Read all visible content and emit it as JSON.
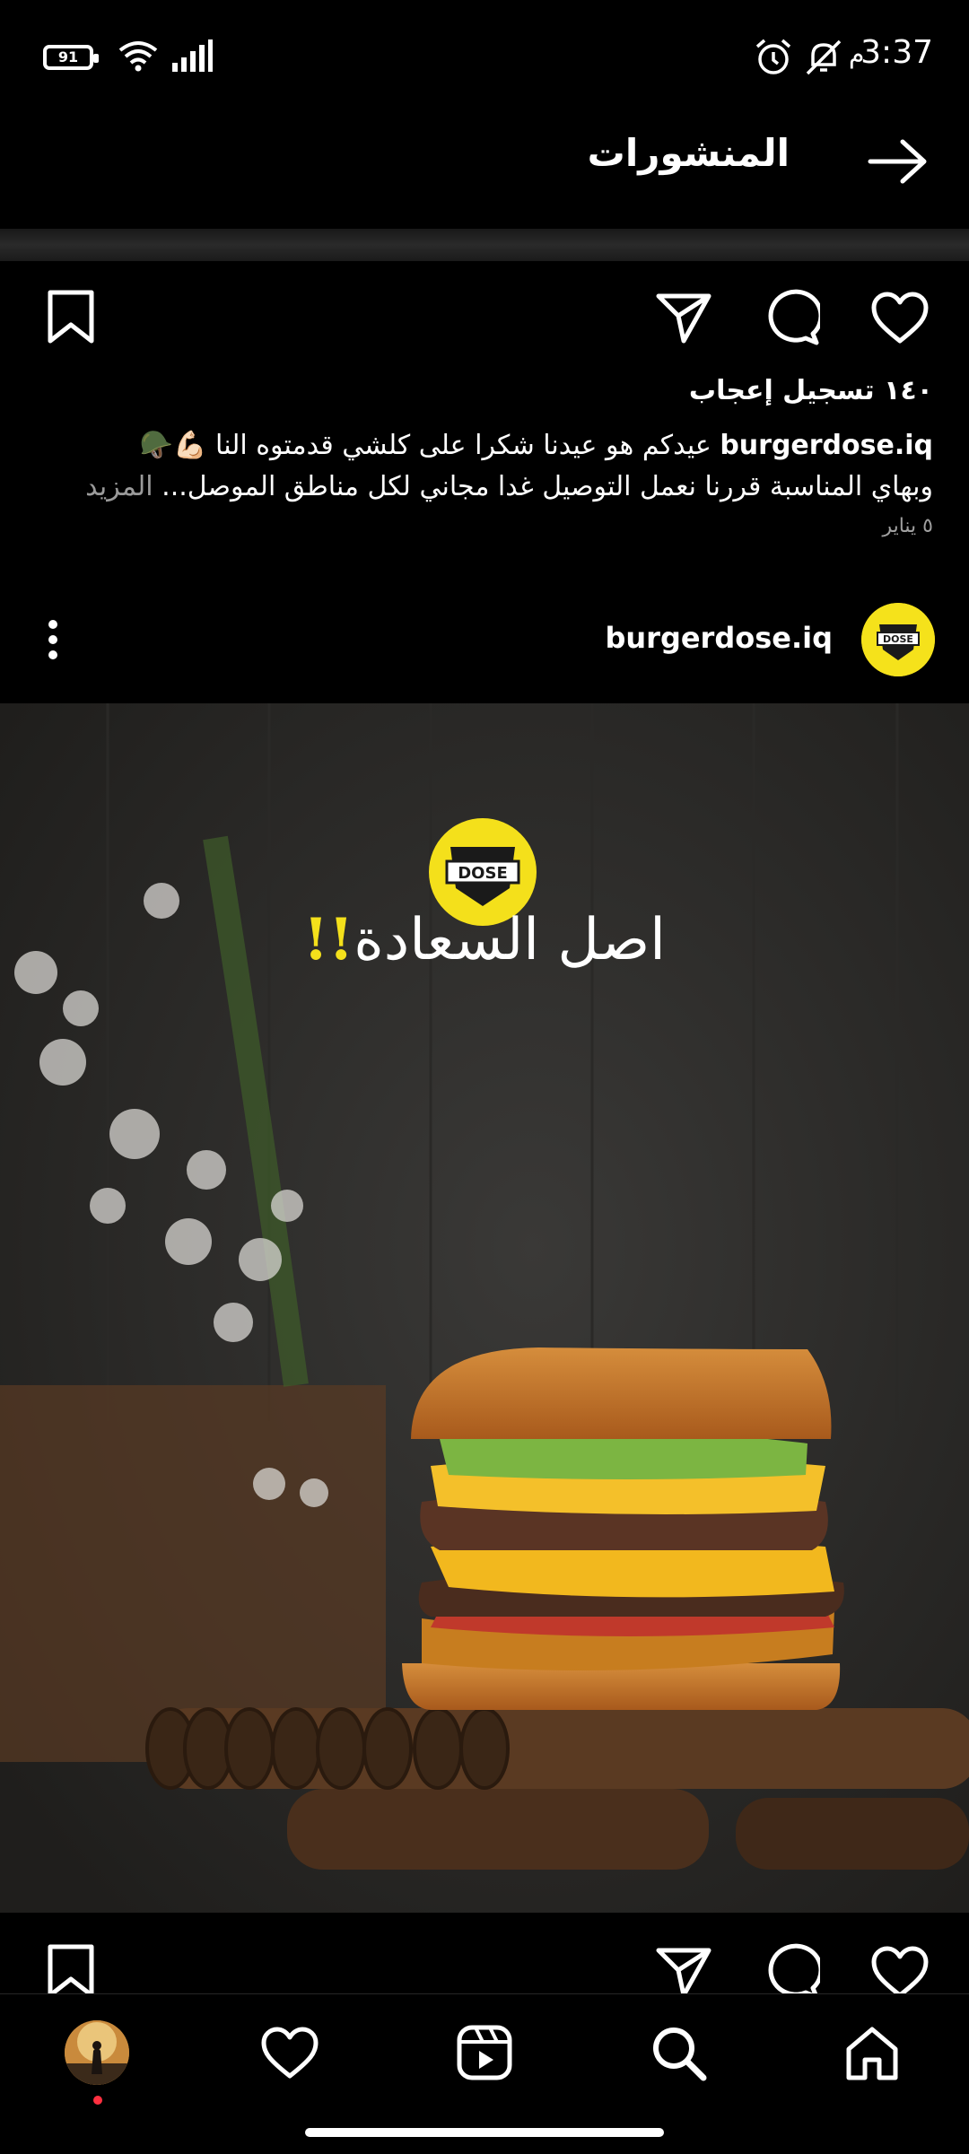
{
  "status_bar": {
    "time": "3:37",
    "am_pm": "م",
    "battery": "91",
    "icons": [
      "alarm-icon",
      "mute-vibrate-icon",
      "wifi-icon",
      "signal-icon"
    ]
  },
  "header": {
    "title": "المنشورات",
    "back_icon": "arrow-right-icon"
  },
  "previous_post": {
    "likes": "١٤٠ تسجيل إعجاب",
    "username": "burgerdose.iq",
    "caption_line1": " عيدكم هو عيدنا شكرا على كلشي قدمتوه النا 💪🏻🪖",
    "caption_line2": "وبهاي المناسبة قررنا نعمل التوصيل غدا مجاني لكل مناطق الموصل...",
    "more": " المزيد",
    "date": "٥ يناير"
  },
  "post": {
    "username": "burgerdose.iq",
    "avatar_text": "DOSE",
    "image": {
      "logo_text": "DOSE",
      "headline": "اصل السعادة",
      "headline_bang": "!!"
    }
  },
  "actions": [
    "heart-icon",
    "comment-icon",
    "share-icon",
    "bookmark-icon"
  ],
  "bottom_nav": [
    "home-icon",
    "search-icon",
    "reels-icon",
    "heart-icon",
    "profile-avatar"
  ],
  "colors": {
    "background": "#000000",
    "brand_yellow": "#f4e01b",
    "notification_red": "#ff3040",
    "muted_text": "#9a9a9a"
  }
}
